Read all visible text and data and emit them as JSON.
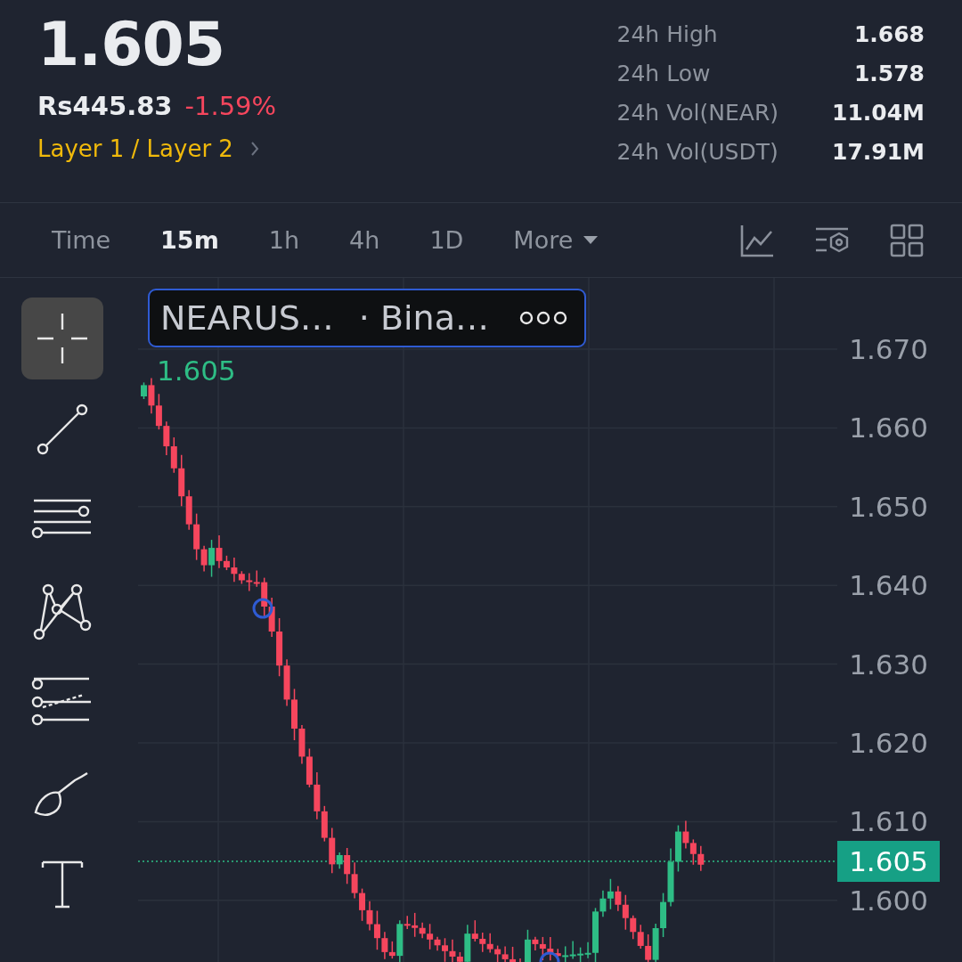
{
  "ticker": {
    "last": "1.605",
    "fiat": "Rs445.83",
    "change": "-1.59%",
    "category": "Layer 1 / Layer 2"
  },
  "stats": [
    {
      "label": "24h High",
      "value": "1.668"
    },
    {
      "label": "24h Low",
      "value": "1.578"
    },
    {
      "label": "24h Vol(NEAR)",
      "value": "11.04M"
    },
    {
      "label": "24h Vol(USDT)",
      "value": "17.91M"
    }
  ],
  "intervals": [
    {
      "label": "Time",
      "selected": false,
      "kind": "tab"
    },
    {
      "label": "15m",
      "selected": true,
      "kind": "tab"
    },
    {
      "label": "1h",
      "selected": false,
      "kind": "tab"
    },
    {
      "label": "4h",
      "selected": false,
      "kind": "tab"
    },
    {
      "label": "1D",
      "selected": false,
      "kind": "tab"
    },
    {
      "label": "More",
      "selected": false,
      "kind": "dropdown"
    }
  ],
  "tools": [
    {
      "kind": "crosshair",
      "selected": true
    },
    {
      "kind": "trend-line",
      "selected": false
    },
    {
      "kind": "levels",
      "selected": false
    },
    {
      "kind": "pattern",
      "selected": false
    },
    {
      "kind": "channel",
      "selected": false
    },
    {
      "kind": "brush",
      "selected": false
    },
    {
      "kind": "text",
      "selected": false
    }
  ],
  "chart": {
    "symbol": "NEARUS…",
    "exchange": "· Bina…",
    "open_label": "1.605",
    "price_axis": [
      "1.670",
      "1.660",
      "1.650",
      "1.640",
      "1.630",
      "1.620",
      "1.610",
      "1.600"
    ],
    "current_price": "1.605"
  }
}
